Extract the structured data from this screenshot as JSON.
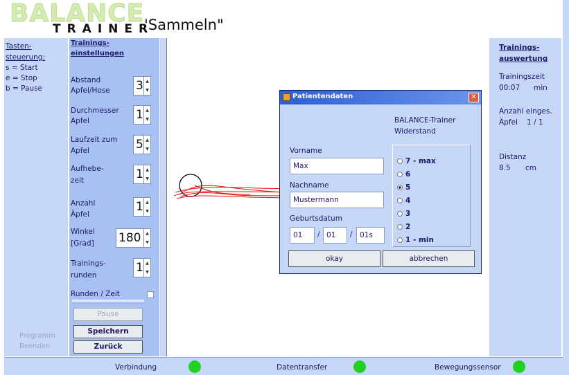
{
  "header": {
    "logo_top": "BALANCE",
    "logo_bottom": "TRAINER",
    "title": "'Sammeln\""
  },
  "left": {
    "heading_1": "Tasten-",
    "heading_2": "steuerung:",
    "keys": [
      "s = Start",
      "e = Stop",
      "b = Pause"
    ],
    "exit_1": "Programm",
    "exit_2": "Beenden"
  },
  "settings": {
    "header_1": "Trainings-",
    "header_2": "einstellungen",
    "fields": [
      {
        "label_1": "Abstand",
        "label_2": "Apfel/Hose",
        "value": "3"
      },
      {
        "label_1": "Durchmesser",
        "label_2": "Apfel",
        "value": "1"
      },
      {
        "label_1": "Laufzeit zum",
        "label_2": "Apfel",
        "value": "5"
      },
      {
        "label_1": "Aufhebe-",
        "label_2": "zeit",
        "value": "1"
      },
      {
        "label_1": "Anzahl",
        "label_2": "Äpfel",
        "value": "1"
      },
      {
        "label_1": "Winkel",
        "label_2": "[Grad]",
        "value": "180"
      },
      {
        "label_1": "Trainings-",
        "label_2": "runden",
        "value": "1"
      }
    ],
    "rounds_time_label": "Runden / Zeit",
    "rounds_time_checked": false,
    "pause_button": "Pause",
    "save_button": "Speichern",
    "back_button": "Zurück"
  },
  "evaluation": {
    "header_1": "Trainings-",
    "header_2": "auswertung",
    "time_label": "Trainingszeit",
    "time_value": "00:07",
    "time_unit": "min",
    "count_label": "Anzahl einges.",
    "count_prefix": "Äpfel",
    "count_value": "1 / 1",
    "distance_label": "Distanz",
    "distance_value": "8.5",
    "distance_unit": "cm"
  },
  "status": {
    "connection": "Verbindung",
    "data_transfer": "Datentransfer",
    "motion_sensor": "Bewegungssensor",
    "led_color": "#22d022"
  },
  "dialog": {
    "title": "Patientendaten",
    "close": "✕",
    "product_1": "BALANCE-Trainer",
    "product_2": "Widerstand",
    "firstname_label": "Vorname",
    "firstname_value": "Max",
    "lastname_label": "Nachname",
    "lastname_value": "Mustermann",
    "birthdate_label": "Geburtsdatum",
    "birth_day": "01",
    "birth_month": "01",
    "birth_year": "01s",
    "sep": "/",
    "resistance_options": [
      "7 - max",
      "6",
      "5",
      "4",
      "3",
      "2",
      "1 - min"
    ],
    "resistance_selected": "5",
    "ok_button": "okay",
    "cancel_button": "abbrechen"
  }
}
